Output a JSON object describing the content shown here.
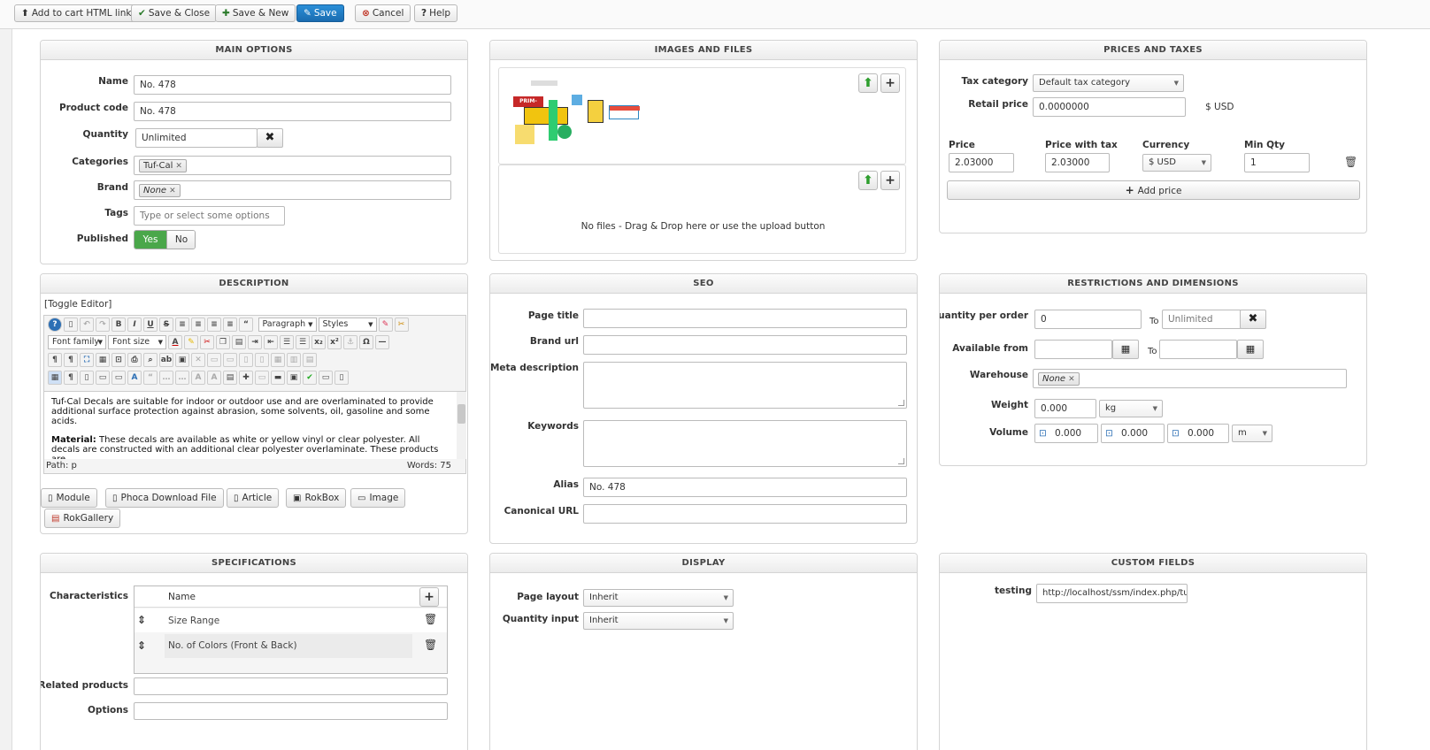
{
  "toolbar": {
    "add_cart_link": "Add to cart HTML link",
    "save_close": "Save & Close",
    "save_new": "Save & New",
    "save": "Save",
    "cancel": "Cancel",
    "help": "Help"
  },
  "main_options": {
    "title": "MAIN OPTIONS",
    "name_label": "Name",
    "name_value": "No. 478",
    "code_label": "Product code",
    "code_value": "No. 478",
    "quantity_label": "Quantity",
    "quantity_value": "Unlimited",
    "categories_label": "Categories",
    "category_tag": "Tuf-Cal",
    "brand_label": "Brand",
    "brand_tag": "None",
    "tags_label": "Tags",
    "tags_placeholder": "Type or select some options",
    "published_label": "Published",
    "published_yes": "Yes",
    "published_no": "No"
  },
  "images": {
    "title": "IMAGES AND FILES",
    "logo_text": "PRIM-FLEX",
    "no_files": "No files - Drag & Drop here or use the upload button"
  },
  "prices": {
    "title": "PRICES AND TAXES",
    "tax_category_label": "Tax category",
    "tax_category_value": "Default tax category",
    "retail_price_label": "Retail price",
    "retail_price_value": "0.0000000",
    "retail_currency": "$ USD",
    "col_price": "Price",
    "col_price_tax": "Price with tax",
    "col_currency": "Currency",
    "col_min_qty": "Min Qty",
    "price_value": "2.03000",
    "price_tax_value": "2.03000",
    "currency_value": "$ USD",
    "min_qty_value": "1",
    "add_price": "Add price"
  },
  "description": {
    "title": "DESCRIPTION",
    "toggle": "[Toggle Editor]",
    "paragraph": "Paragraph",
    "styles": "Styles",
    "font_family": "Font family",
    "font_size": "Font size",
    "text_p1": "Tuf-Cal Decals are suitable for indoor or outdoor use and are overlaminated to provide additional surface protection against abrasion, some solvents, oil, gasoline and some acids.",
    "text_bold": "Material:",
    "text_p2": " These decals are available as white or yellow vinyl or clear polyester. All decals are constructed with an additional clear polyester overlaminate. These products are",
    "path": "Path: p",
    "words": "Words: 75",
    "btn_module": "Module",
    "btn_phoca": "Phoca Download File",
    "btn_article": "Article",
    "btn_rokbox": "RokBox",
    "btn_image": "Image",
    "btn_rokgallery": "RokGallery"
  },
  "seo": {
    "title": "SEO",
    "page_title_label": "Page title",
    "brand_url_label": "Brand url",
    "meta_desc_label": "Meta description",
    "keywords_label": "Keywords",
    "alias_label": "Alias",
    "alias_value": "No. 478",
    "canonical_label": "Canonical URL"
  },
  "restrictions": {
    "title": "RESTRICTIONS AND DIMENSIONS",
    "qty_order_label": "Quantity per order",
    "qty_order_from": "0",
    "to_label": "To",
    "qty_order_to": "Unlimited",
    "available_from_label": "Available from",
    "warehouse_label": "Warehouse",
    "warehouse_tag": "None",
    "weight_label": "Weight",
    "weight_value": "0.000",
    "weight_unit": "kg",
    "volume_label": "Volume",
    "volume_1": "0.000",
    "volume_2": "0.000",
    "volume_3": "0.000",
    "volume_unit": "m"
  },
  "specifications": {
    "title": "SPECIFICATIONS",
    "characteristics_label": "Characteristics",
    "col_name": "Name",
    "rows": [
      "Size Range",
      "No. of Colors (Front & Back)"
    ],
    "related_label": "Related products",
    "options_label": "Options"
  },
  "display": {
    "title": "DISPLAY",
    "page_layout_label": "Page layout",
    "page_layout_value": "Inherit",
    "qty_input_label": "Quantity input",
    "qty_input_value": "Inherit"
  },
  "custom_fields": {
    "title": "CUSTOM FIELDS",
    "testing_label": "testing",
    "testing_value": "http://localhost/ssm/index.php/tuf-ca"
  }
}
